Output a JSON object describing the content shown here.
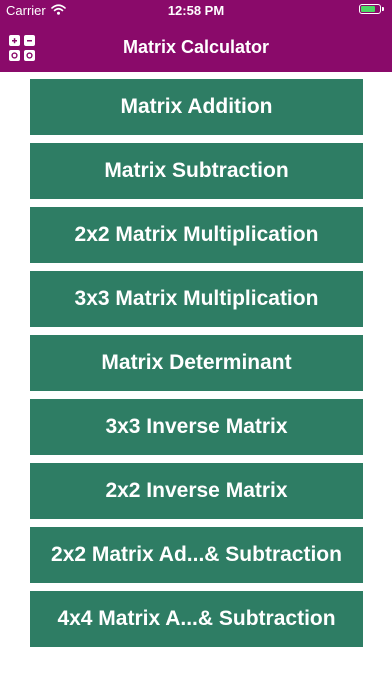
{
  "status_bar": {
    "carrier": "Carrier",
    "time": "12:58 PM",
    "battery_level": 0.8,
    "battery_color": "#4cd964"
  },
  "nav": {
    "title": "Matrix Calculator",
    "menu_icon": "grid-menu-icon",
    "background_color": "#8a0a6a"
  },
  "menu": {
    "button_color": "#2e7d64",
    "items": [
      {
        "label": "Matrix Addition"
      },
      {
        "label": "Matrix Subtraction"
      },
      {
        "label": "2x2 Matrix Multiplication"
      },
      {
        "label": "3x3 Matrix Multiplication"
      },
      {
        "label": "Matrix Determinant"
      },
      {
        "label": "3x3 Inverse Matrix"
      },
      {
        "label": "2x2 Inverse Matrix"
      },
      {
        "label": "2x2 Matrix Ad...& Subtraction"
      },
      {
        "label": "4x4 Matrix A...& Subtraction"
      }
    ]
  }
}
